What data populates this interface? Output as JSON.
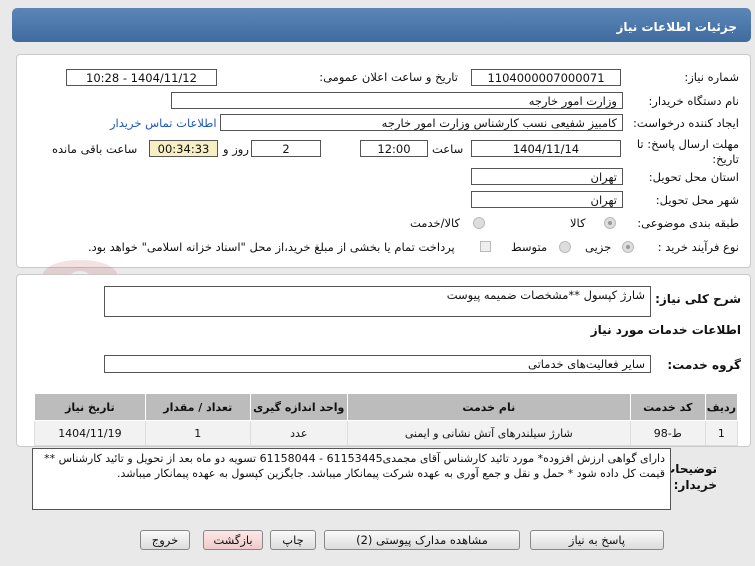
{
  "header": {
    "title": "جزئیات اطلاعات نیاز"
  },
  "form": {
    "need_number_label": "شماره نیاز:",
    "need_number": "1104000007000071",
    "announce_label": "تاریخ و ساعت اعلان عمومی:",
    "announce_value": "1404/11/12 - 10:28",
    "buyer_org_label": "نام دستگاه خریدار:",
    "buyer_org": "وزارت امور خارجه",
    "creator_label": "ایجاد کننده درخواست:",
    "creator": "کامبیز شفیعی نسب کارشناس وزارت امور خارجه",
    "contact_link": "اطلاعات تماس خریدار",
    "deadline_label_1": "مهلت ارسال پاسخ: تا",
    "deadline_label_2": "تاریخ:",
    "deadline_date": "1404/11/14",
    "time_label": "ساعت",
    "deadline_time": "12:00",
    "days_value": "2",
    "days_label": "روز و",
    "remaining_time": "00:34:33",
    "remaining_label": "ساعت باقی مانده",
    "province_label": "استان محل تحویل:",
    "province": "تهران",
    "city_label": "شهر محل تحویل:",
    "city": "تهران",
    "category_label": "طبقه بندی موضوعی:",
    "category_options": [
      "کالا",
      "کالا/خدمت"
    ],
    "process_label": "نوع فرآیند خرید :",
    "process_options": [
      "جزیی",
      "متوسط"
    ],
    "payment_text": "پرداخت تمام یا بخشی از مبلغ خرید،از محل \"اسناد خزانه اسلامی\" خواهد بود."
  },
  "description": {
    "label": "شرح کلی نیاز:",
    "value": "شارژ کپسول **مشخصات ضمیمه پیوست"
  },
  "services": {
    "section_title": "اطلاعات خدمات مورد نیاز",
    "group_label": "گروه خدمت:",
    "group_value": "سایر فعالیت‌های خدماتی",
    "columns": [
      "ردیف",
      "کد خدمت",
      "نام خدمت",
      "واحد اندازه گیری",
      "تعداد / مقدار",
      "تاریخ نیاز"
    ],
    "rows": [
      {
        "row": "1",
        "code": "ط-98",
        "name": "شارژ سیلندرهای آتش نشانی و ایمنی",
        "unit": "عدد",
        "qty": "1",
        "date": "1404/11/19"
      }
    ]
  },
  "buyer_notes": {
    "label_1": "توضیحات",
    "label_2": "خریدار:",
    "text": "دارای گواهی ارزش افزوده* مورد تائید کارشناس آقای مجمدی61153445 - 61158044  تسویه دو ماه بعد از تحویل و تائید کارشناس ** قیمت کل داده شود * حمل و نقل و جمع آوری به عهده شرکت پیمانکار  میباشد. جایگزین کپسول به عهده پیمانکار میباشد."
  },
  "buttons": {
    "reply": "پاسخ به نیاز",
    "docs": "مشاهده مدارک پیوستی (2)",
    "print": "چاپ",
    "back": "بازگشت",
    "exit": "خروج"
  },
  "watermark_brand": "AriaTender.net",
  "colors": {
    "header": "#4a77aa",
    "link": "#1f57b7",
    "watermark": "#b22222"
  }
}
